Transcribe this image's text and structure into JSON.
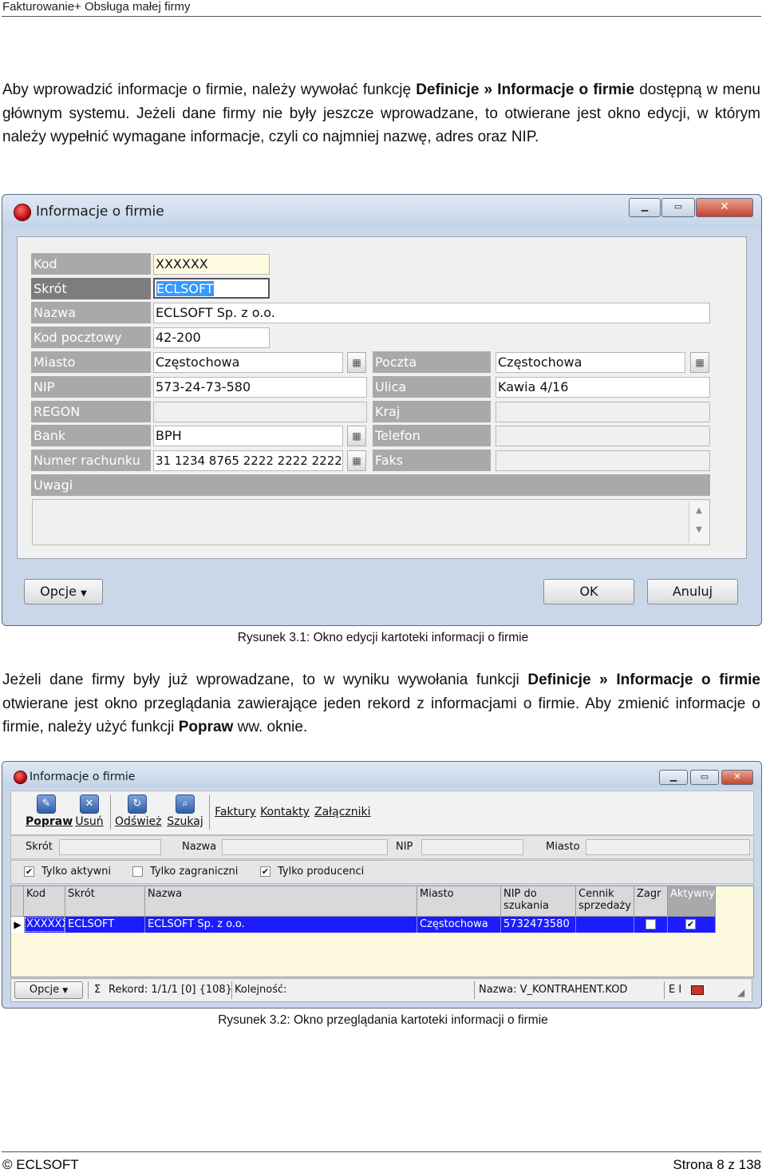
{
  "header": {
    "title": "Fakturowanie+ Obsługa małej firmy"
  },
  "para1": {
    "t1": "Aby wprowadzić informacje o firmie, należy wywołać funkcję ",
    "b1": "Definicje » Informacje o firmie",
    "t2": " dostępną w menu głównym systemu. Jeżeli dane firmy nie były jeszcze wprowadzane, to otwierane jest okno edycji, w którym należy wypełnić wymagane informacje, czyli co najmniej nazwę, adres oraz NIP."
  },
  "win1": {
    "title": "Informacje o firmie",
    "labels": {
      "kod": "Kod",
      "skrot": "Skrót",
      "nazwa": "Nazwa",
      "kod_pocztowy": "Kod pocztowy",
      "miasto": "Miasto",
      "nip": "NIP",
      "regon": "REGON",
      "bank": "Bank",
      "numer_rachunku": "Numer rachunku",
      "uwagi": "Uwagi",
      "poczta": "Poczta",
      "ulica": "Ulica",
      "kraj": "Kraj",
      "telefon": "Telefon",
      "faks": "Faks"
    },
    "values": {
      "kod": "XXXXXX",
      "skrot": "ECLSOFT",
      "nazwa": "ECLSOFT Sp. z o.o.",
      "kod_pocztowy": "42-200",
      "miasto": "Częstochowa",
      "nip": "573-24-73-580",
      "regon": "",
      "bank": "BPH",
      "numer_rachunku": "31 1234 8765 2222 2222 2222",
      "poczta": "Częstochowa",
      "ulica": "Kawia 4/16",
      "kraj": "",
      "telefon": "",
      "faks": "",
      "uwagi": ""
    },
    "buttons": {
      "opcje": "Opcje",
      "ok": "OK",
      "anuluj": "Anuluj"
    }
  },
  "caption1": "Rysunek 3.1: Okno edycji kartoteki informacji o firmie",
  "para2": {
    "t1": "Jeżeli dane firmy były już wprowadzane, to w wyniku wywołania funkcji ",
    "b1": "Definicje » Informacje o firmie",
    "t2": " otwierane jest okno przeglądania zawierające jeden rekord z informacjami o firmie. Aby zmienić informacje o firmie, należy użyć funkcji ",
    "b2": "Popraw",
    "t3": " ww. oknie."
  },
  "win2": {
    "title": "Informacje o firmie",
    "toolbar": {
      "popraw": "Popraw",
      "usun": "Usuń",
      "odswiez": "Odśwież",
      "szukaj": "Szukaj",
      "faktury": "Faktury",
      "kontakty": "Kontakty",
      "zalaczniki": "Załączniki"
    },
    "filters": {
      "skrot": "Skrót",
      "nazwa": "Nazwa",
      "nip": "NIP",
      "miasto": "Miasto"
    },
    "checks": [
      {
        "label": "Tylko aktywni",
        "checked": true
      },
      {
        "label": "Tylko zagraniczni",
        "checked": false
      },
      {
        "label": "Tylko producenci",
        "checked": true
      }
    ],
    "columns": [
      "Kod",
      "Skrót",
      "Nazwa",
      "Miasto",
      "NIP do szukania",
      "Cennik sprzedaży",
      "Zagr",
      "Aktywny"
    ],
    "row": {
      "kod": "XXXXXX",
      "skrot": "ECLSOFT",
      "nazwa": "ECLSOFT Sp. z o.o.",
      "miasto": "Częstochowa",
      "nip": "5732473580",
      "cennik": "",
      "zagr": false,
      "aktywny": true
    },
    "status": {
      "opcje": "Opcje",
      "sigma": "Σ",
      "rekord": "Rekord: 1/1/1 [0] {108}",
      "kolejnosc": "Kolejność:",
      "nazwa": "Nazwa: V_KONTRAHENT.KOD",
      "ei": "E I"
    }
  },
  "caption2": "Rysunek 3.2: Okno przeglądania kartoteki informacji o firmie",
  "footer": {
    "left": "© ECLSOFT",
    "right": "Strona 8 z 138"
  },
  "colors": {
    "selection": "#1c1cff",
    "label_bg": "#a9a9a9",
    "grid_bg": "#fbf8dd"
  }
}
